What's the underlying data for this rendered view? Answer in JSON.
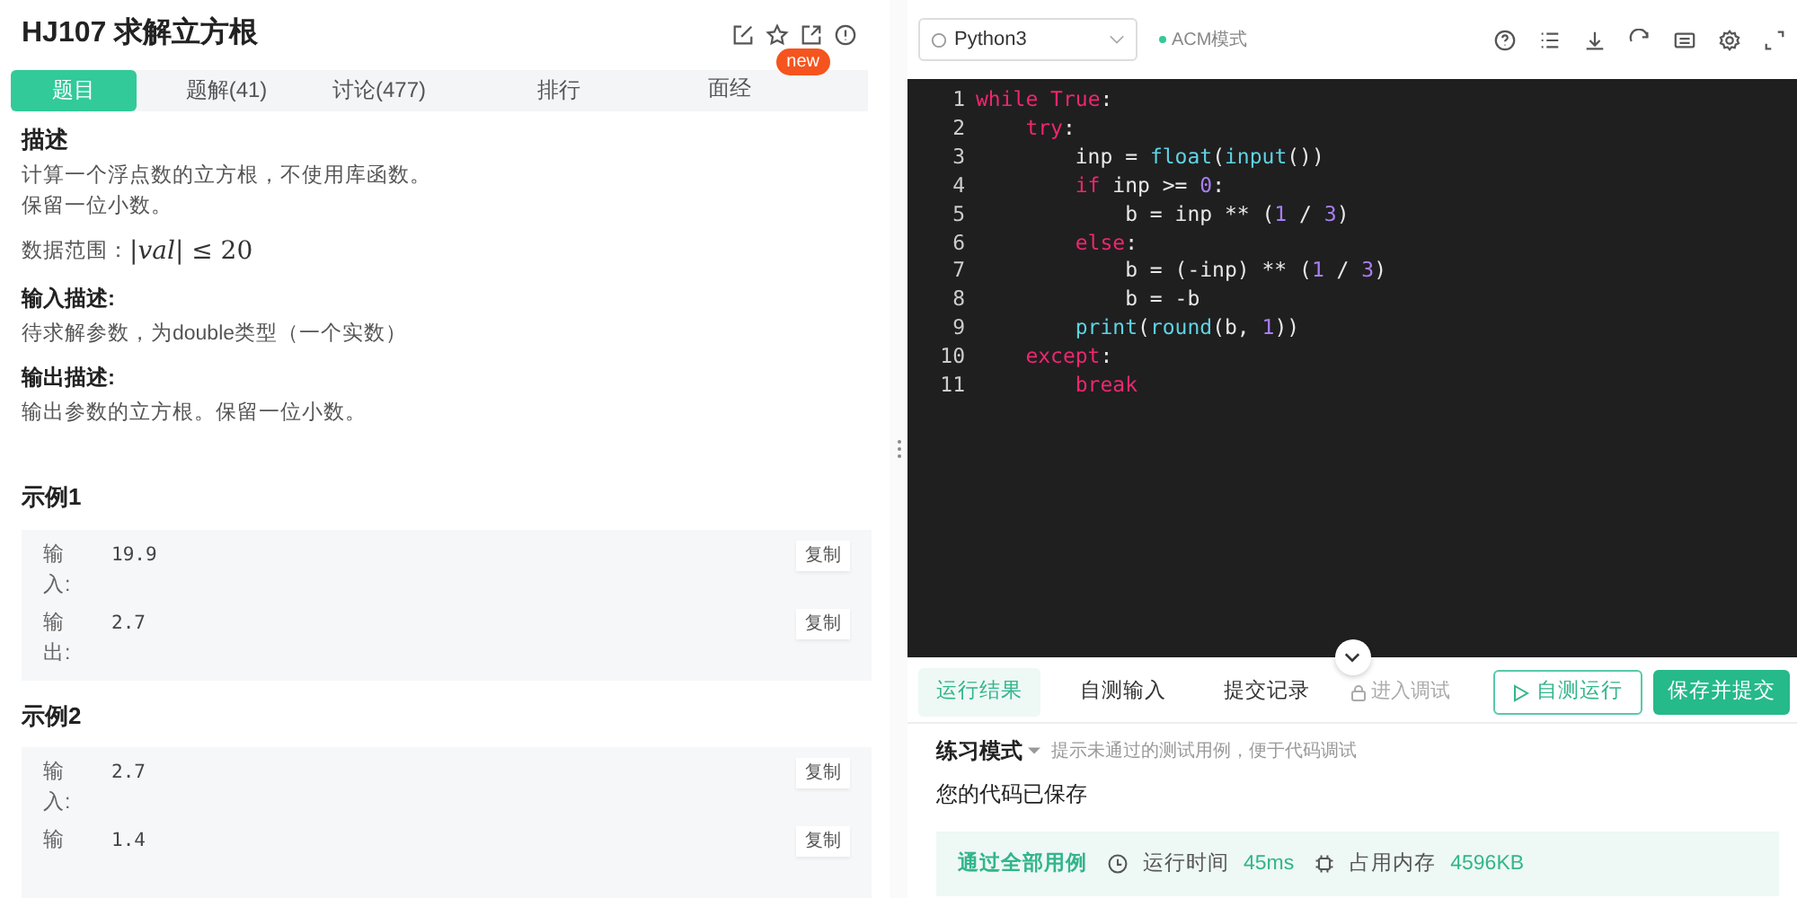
{
  "problem": {
    "title": "HJ107  求解立方根"
  },
  "tabs": [
    {
      "label": "题目",
      "selected": true
    },
    {
      "label": "题解(41)",
      "selected": false
    },
    {
      "label": "讨论(477)",
      "selected": false
    },
    {
      "label": "排行",
      "selected": false
    },
    {
      "label": "面经",
      "selected": false,
      "badge": "new"
    }
  ],
  "description": {
    "heading": "描述",
    "lines": [
      "计算一个浮点数的立方根，不使用库函数。",
      "保留一位小数。"
    ],
    "range_label": "数据范围：",
    "range_math": "|*val*| ≤ 20"
  },
  "input_description": {
    "heading": "输入描述:",
    "text": "待求解参数，为double类型（一个实数）"
  },
  "output_description": {
    "heading": "输出描述:",
    "text": "输出参数的立方根。保留一位小数。"
  },
  "examples": [
    {
      "heading": "示例1",
      "rows": [
        {
          "label": "输入:",
          "value": "19.9",
          "copy": "复制"
        },
        {
          "label": "输出:",
          "value": "2.7",
          "copy": "复制"
        }
      ]
    },
    {
      "heading": "示例2",
      "rows": [
        {
          "label": "输入:",
          "value": "2.7",
          "copy": "复制"
        },
        {
          "label": "输",
          "value": "1.4",
          "copy": "复制"
        }
      ]
    }
  ],
  "editor": {
    "language": "Python3",
    "mode": "ACM模式",
    "code": [
      [
        {
          "keyword": "while"
        },
        {
          "keyword": " True"
        },
        {
          "plain": ":"
        }
      ],
      [
        {
          "keyword": "    try"
        },
        {
          "plain": ":"
        }
      ],
      [
        {
          "plain": "        inp = "
        },
        {
          "function": "float"
        },
        {
          "plain": "("
        },
        {
          "function": "input"
        },
        {
          "plain": "())"
        }
      ],
      [
        {
          "keyword": "        if"
        },
        {
          "plain": " inp >= "
        },
        {
          "number": "0"
        },
        {
          "plain": ":"
        }
      ],
      [
        {
          "plain": "            b = inp ** ("
        },
        {
          "number": "1"
        },
        {
          "plain": " / "
        },
        {
          "number": "3"
        },
        {
          "plain": ")"
        }
      ],
      [
        {
          "keyword": "        else"
        },
        {
          "plain": ":"
        }
      ],
      [
        {
          "plain": "            b = (-inp) ** ("
        },
        {
          "number": "1"
        },
        {
          "plain": " / "
        },
        {
          "number": "3"
        },
        {
          "plain": ")"
        }
      ],
      [
        {
          "plain": "            b = -b"
        }
      ],
      [
        {
          "function": "        print"
        },
        {
          "plain": "("
        },
        {
          "function": "round"
        },
        {
          "plain": "(b, "
        },
        {
          "number": "1"
        },
        {
          "plain": "))"
        }
      ],
      [
        {
          "keyword": "    except"
        },
        {
          "plain": ":"
        }
      ],
      [
        {
          "keyword": "        break"
        }
      ]
    ],
    "line_numbers": [
      "1",
      "2",
      "3",
      "4",
      "5",
      "6",
      "7",
      "8",
      "9",
      "10",
      "11"
    ]
  },
  "result_tabs": [
    {
      "label": "运行结果",
      "selected": true
    },
    {
      "label": "自测输入",
      "selected": false
    },
    {
      "label": "提交记录",
      "selected": false
    }
  ],
  "debug_button": {
    "label": "进入调试",
    "disabled": true
  },
  "run_button": "自测运行",
  "submit_button": "保存并提交",
  "practice": {
    "mode": "练习模式",
    "hint": "提示未通过的测试用例，便于代码调试"
  },
  "saved_message": "您的代码已保存",
  "result": {
    "status": "通过全部用例",
    "time_label": "运行时间",
    "time": "45ms",
    "memory_label": "占用内存",
    "memory": "4596KB"
  }
}
